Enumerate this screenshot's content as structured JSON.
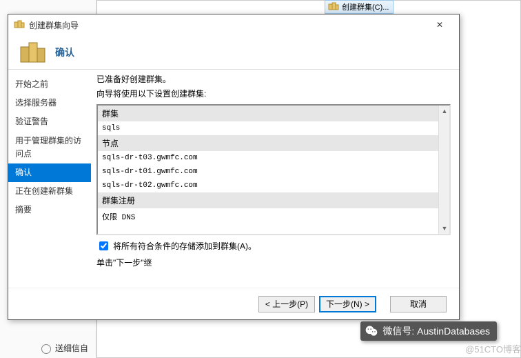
{
  "bg_taskbar": {
    "label": "创建群集(C)..."
  },
  "dialog": {
    "title": "创建群集向导",
    "header": "确认",
    "close": "✕",
    "nav": {
      "items": [
        {
          "label": "开始之前"
        },
        {
          "label": "选择服务器"
        },
        {
          "label": "验证警告"
        },
        {
          "label": "用于管理群集的访问点"
        },
        {
          "label": "确认",
          "selected": true
        },
        {
          "label": "正在创建新群集"
        },
        {
          "label": "摘要"
        }
      ]
    },
    "content": {
      "intro1": "已准备好创建群集。",
      "intro2": "向导将使用以下设置创建群集:",
      "sections": [
        {
          "header": "群集",
          "values": [
            "sqls"
          ]
        },
        {
          "header": "节点",
          "values": [
            "sqls-dr-t03.gwmfc.com",
            "sqls-dr-t01.gwmfc.com",
            "sqls-dr-t02.gwmfc.com"
          ]
        },
        {
          "header": "群集注册",
          "values": [
            "仅限 DNS"
          ]
        }
      ],
      "checkbox": "将所有符合条件的存储添加到群集(A)。",
      "hint": "单击\"下一步\"继"
    },
    "footer": {
      "prev": "< 上一步(P)",
      "next": "下一步(N) >",
      "cancel": "取消"
    }
  },
  "wechat": {
    "label": "微信号: AustinDatabases"
  },
  "watermark": "@51CTO博客",
  "underlay_item": "送细信自"
}
